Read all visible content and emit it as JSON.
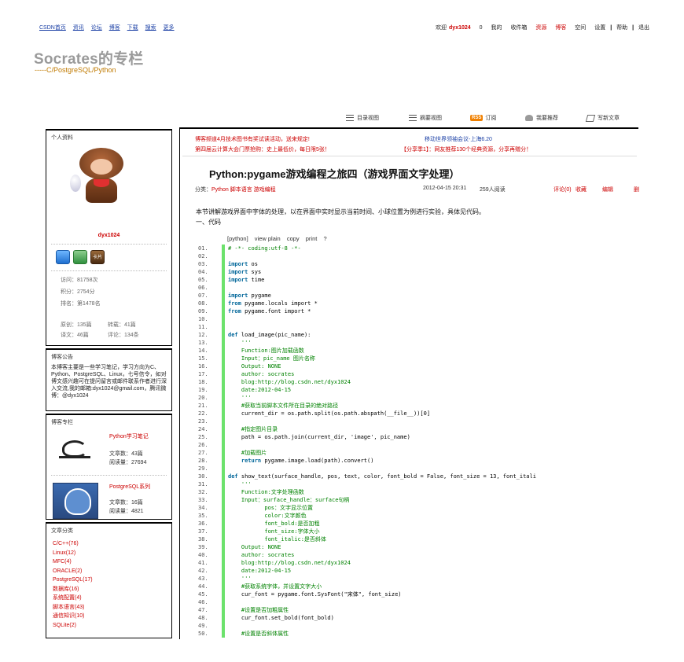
{
  "topnav": {
    "links": [
      "CSDN首页",
      "资讯",
      "论坛",
      "博客",
      "下载",
      "搜索",
      "更多"
    ],
    "welcome": "欢迎",
    "username": "dyx1024",
    "count": "0",
    "mine": "我的",
    "inbox": "收件箱",
    "resources": "资源",
    "blog": "博客",
    "space": "空间",
    "settings": "设置",
    "help": "帮助",
    "logout": "退出"
  },
  "blog": {
    "title": "Socrates的专栏",
    "subtitle": "-----C/PostgreSQL/Python"
  },
  "toolbar": {
    "directory_view": "目录视图",
    "summary_view": "摘要视图",
    "rss_badge": "RSS",
    "subscribe": "订阅",
    "recommend": "我要推荐",
    "write": "写新文章"
  },
  "profile": {
    "title": "个人资料",
    "username": "dyx1024",
    "badge3": "卡片",
    "visits": "访问：81758次",
    "points": "积分：2754分",
    "rank": "排名：第1478名",
    "original": "原创：135篇",
    "reposted": "转载：41篇",
    "translated": "译文：46篇",
    "comments": "评论：134条"
  },
  "announcement": {
    "title": "博客公告",
    "text": "本博客主要是一些学习笔记，学习方向为C、Python、PostgreSQL、Linux，七号信令，如对博文感兴趣可在提问留言或邮件联系作者进行深入交流,我的邮箱:dyx1024@gmail.com，腾讯微博：@dyx1024"
  },
  "columns": {
    "title": "博客专栏",
    "items": [
      {
        "name": "Python学习笔记",
        "articles": "文章数：43篇",
        "reads": "阅读量：27694"
      },
      {
        "name": "PostgreSQL系列",
        "articles": "文章数：16篇",
        "reads": "阅读量：4821"
      }
    ]
  },
  "categories": {
    "title": "文章分类",
    "items": [
      "C/C++(76)",
      "Linux(12)",
      "MFC(4)",
      "ORACLE(2)",
      "PostgreSQL(17)",
      "数据库(16)",
      "系统配置(4)",
      "脚本语言(43)",
      "通信知识(10)",
      "SQLite(2)"
    ]
  },
  "notices": {
    "line1_left": "博客频道4月技术图书有奖试读活动，送来规定!",
    "line1_right": "移动世界领袖会议-上海6.20",
    "line2_left": "第四届云计算大会门票抢购：史上最低价，每日限5张！",
    "line2_right": "【分享季1】：网友推荐130个经典资源，分享再赠分！"
  },
  "article": {
    "title": "Python:pygame游戏编程之旅四（游戏界面文字处理）",
    "category_label": "分类：",
    "categories": "Python 脚本语言 游戏编程",
    "date": "2012-04-15 20:31",
    "reads": "259人阅读",
    "comments": "评论(0)",
    "favorite": "收藏",
    "edit": "编辑",
    "delete": "删",
    "intro": "本节讲解游戏界面中字体的处理，以在界面中实时显示当前时间、小球位置为例进行实验，具体见代码。",
    "section": "一、代码"
  },
  "code": {
    "header": [
      "[python]",
      "view plain",
      "copy",
      "print",
      "?"
    ],
    "lines": [
      {
        "n": "01.",
        "t": "# -*- coding:utf-8 -*-"
      },
      {
        "n": "02.",
        "t": ""
      },
      {
        "n": "03.",
        "t": "import os"
      },
      {
        "n": "04.",
        "t": "import sys"
      },
      {
        "n": "05.",
        "t": "import time"
      },
      {
        "n": "06.",
        "t": ""
      },
      {
        "n": "07.",
        "t": "import pygame"
      },
      {
        "n": "08.",
        "t": "from pygame.locals import *"
      },
      {
        "n": "09.",
        "t": "from pygame.font import *"
      },
      {
        "n": "10.",
        "t": ""
      },
      {
        "n": "11.",
        "t": ""
      },
      {
        "n": "12.",
        "t": "def load_image(pic_name):"
      },
      {
        "n": "13.",
        "t": "    '''"
      },
      {
        "n": "14.",
        "t": "    Function:图片加载函数"
      },
      {
        "n": "15.",
        "t": "    Input：pic_name 图片名称"
      },
      {
        "n": "16.",
        "t": "    Output: NONE"
      },
      {
        "n": "17.",
        "t": "    author: socrates"
      },
      {
        "n": "18.",
        "t": "    blog:http://blog.csdn.net/dyx1024"
      },
      {
        "n": "19.",
        "t": "    date:2012-04-15"
      },
      {
        "n": "20.",
        "t": "    '''"
      },
      {
        "n": "21.",
        "t": "    #获取当前脚本文件所在目录的绝对路径"
      },
      {
        "n": "22.",
        "t": "    current_dir = os.path.split(os.path.abspath(__file__))[0]"
      },
      {
        "n": "23.",
        "t": ""
      },
      {
        "n": "24.",
        "t": "    #指定图片目录"
      },
      {
        "n": "25.",
        "t": "    path = os.path.join(current_dir, 'image', pic_name)"
      },
      {
        "n": "26.",
        "t": ""
      },
      {
        "n": "27.",
        "t": "    #加载图片"
      },
      {
        "n": "28.",
        "t": "    return pygame.image.load(path).convert()"
      },
      {
        "n": "29.",
        "t": ""
      },
      {
        "n": "30.",
        "t": "def show_text(surface_handle, pos, text, color, font_bold = False, font_size = 13, font_itali"
      },
      {
        "n": "31.",
        "t": "    '''"
      },
      {
        "n": "32.",
        "t": "    Function:文字处理函数"
      },
      {
        "n": "33.",
        "t": "    Input：surface_handle：surface句柄"
      },
      {
        "n": "34.",
        "t": "           pos：文字显示位置"
      },
      {
        "n": "35.",
        "t": "           color:文字颜色"
      },
      {
        "n": "36.",
        "t": "           font_bold:是否加粗"
      },
      {
        "n": "37.",
        "t": "           font_size:字体大小"
      },
      {
        "n": "38.",
        "t": "           font_italic:是否斜体"
      },
      {
        "n": "39.",
        "t": "    Output: NONE"
      },
      {
        "n": "40.",
        "t": "    author: socrates"
      },
      {
        "n": "41.",
        "t": "    blog:http://blog.csdn.net/dyx1024"
      },
      {
        "n": "42.",
        "t": "    date:2012-04-15"
      },
      {
        "n": "43.",
        "t": "    '''"
      },
      {
        "n": "44.",
        "t": "    #获取系统字体，并设置文字大小"
      },
      {
        "n": "45.",
        "t": "    cur_font = pygame.font.SysFont(\"宋体\", font_size)"
      },
      {
        "n": "46.",
        "t": ""
      },
      {
        "n": "47.",
        "t": "    #设置是否加粗属性"
      },
      {
        "n": "48.",
        "t": "    cur_font.set_bold(font_bold)"
      },
      {
        "n": "49.",
        "t": ""
      },
      {
        "n": "50.",
        "t": "    #设置是否斜体属性"
      }
    ]
  }
}
